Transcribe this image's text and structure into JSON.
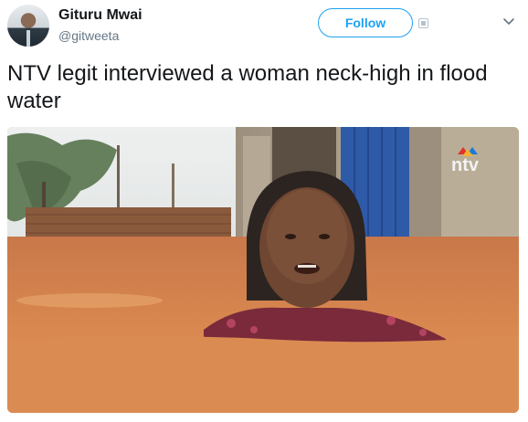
{
  "tweet": {
    "author_name": "Gituru Mwai",
    "author_handle": "@gitweeta",
    "follow_label": "Follow",
    "text": "NTV legit interviewed a woman neck-high in flood water",
    "media": {
      "watermark": "ntv"
    }
  },
  "icons": {
    "qr": "qr-code-icon",
    "caret": "chevron-down-icon"
  },
  "colors": {
    "accent": "#1da1f2",
    "text": "#14171a",
    "secondary_text": "#657786",
    "logo_red": "#e2342b",
    "logo_blue": "#1a7ad8"
  }
}
